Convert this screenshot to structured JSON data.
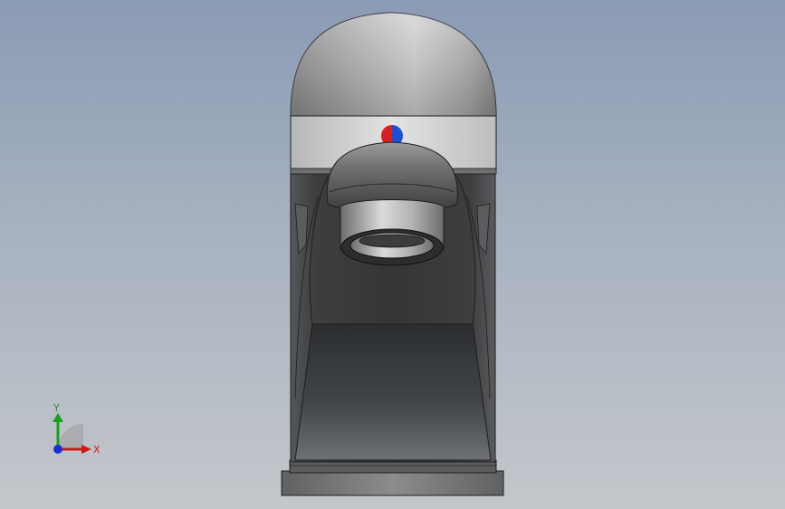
{
  "viewport": {
    "background_top": "#8a9bb4",
    "background_bottom": "#c4c7cb"
  },
  "model": {
    "body_color": "#3c3e40",
    "cap_color": "#8e8e8e",
    "band_color": "#cfcfcf",
    "indicator_hot_color": "#d62020",
    "indicator_cold_color": "#1d4fd6"
  },
  "triad": {
    "x_label": "X",
    "y_label": "Y",
    "x_color": "#d01818",
    "y_color": "#18a018",
    "z_color": "#1a2fd0"
  }
}
